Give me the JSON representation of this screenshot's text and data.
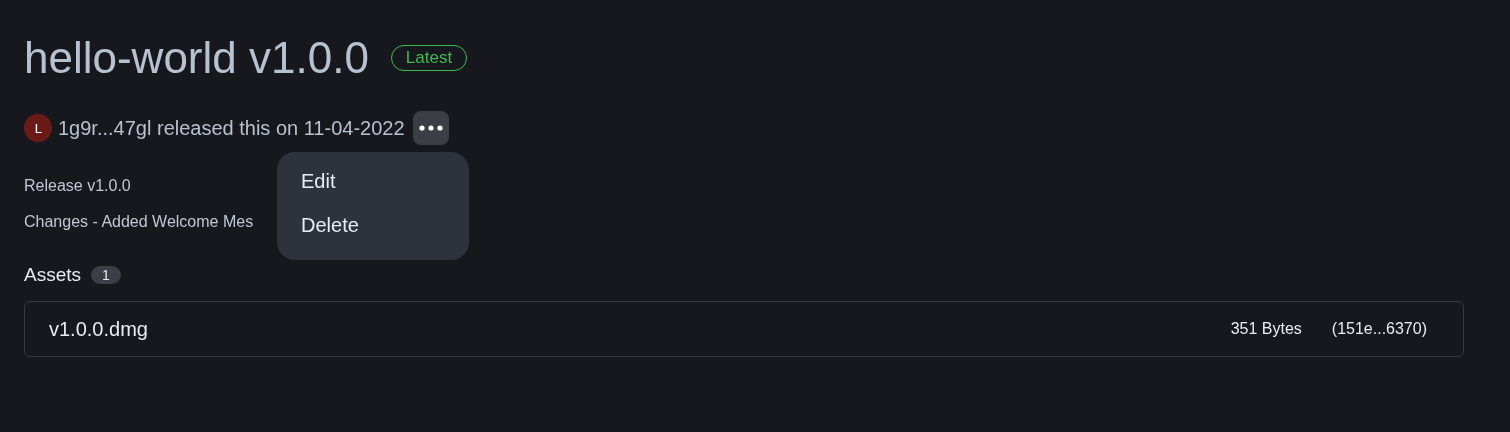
{
  "release": {
    "title": "hello-world v1.0.0",
    "badge": "Latest",
    "avatar_letter": "L",
    "byline": "1g9r...47gl released this on 11-04-2022",
    "notes": [
      "Release v1.0.0",
      "Changes - Added Welcome Mes"
    ]
  },
  "menu": {
    "open": true,
    "items": [
      {
        "label": "Edit"
      },
      {
        "label": "Delete"
      }
    ]
  },
  "assets": {
    "heading": "Assets",
    "count": "1",
    "items": [
      {
        "name": "v1.0.0.dmg",
        "size": "351 Bytes",
        "hash": "(151e...6370)"
      }
    ]
  }
}
